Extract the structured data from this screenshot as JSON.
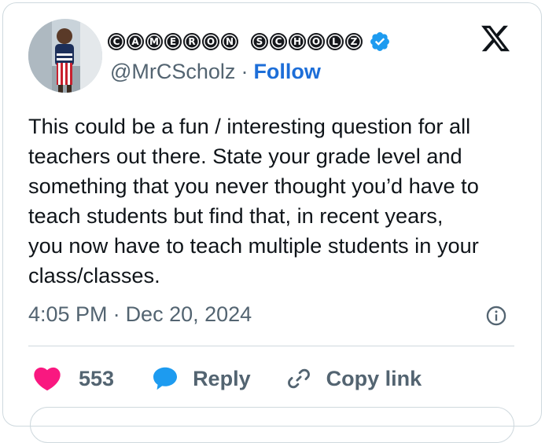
{
  "author": {
    "display_name_letters": [
      "C",
      "A",
      "M",
      "E",
      "R",
      "O",
      "N",
      " ",
      "S",
      "C",
      "H",
      "O",
      "L",
      "Z"
    ],
    "handle": "@MrCScholz",
    "separator": "·",
    "follow_label": "Follow",
    "verified": true
  },
  "tweet": {
    "lines": [
      "This could be a fun / interesting question for all",
      "teachers out there. State your grade level and",
      "something that you never thought you’d have to",
      "teach students but find that, in recent years,",
      "you now have to teach multiple students in your",
      "class/classes."
    ]
  },
  "meta": {
    "time": "4:05 PM",
    "separator": "·",
    "date": "Dec 20, 2024"
  },
  "actions": {
    "like_count": "553",
    "reply_label": "Reply",
    "copy_link_label": "Copy link"
  },
  "colors": {
    "like": "#f91880",
    "reply": "#1d9bf0",
    "verified": "#1d9bf0",
    "follow": "#1d6ed8",
    "muted": "#536471"
  },
  "icons": {
    "brand": "x-logo-icon",
    "verified": "verified-badge-icon",
    "info": "info-icon",
    "like": "heart-icon",
    "reply": "speech-bubble-icon",
    "copy_link": "link-icon"
  }
}
